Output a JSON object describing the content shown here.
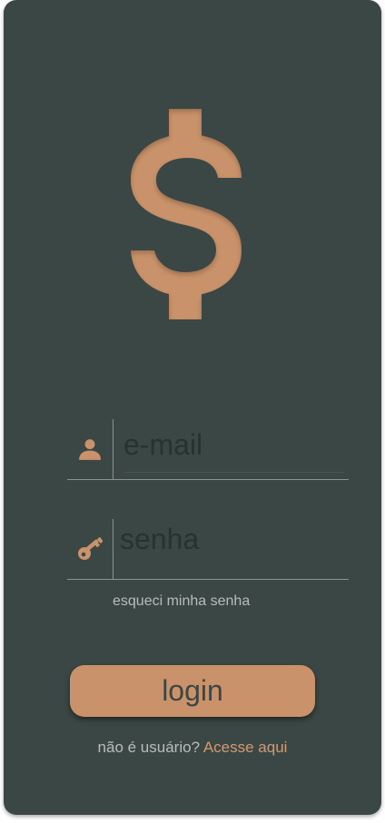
{
  "colors": {
    "background": "#3b4744",
    "accent": "#c9926a",
    "muted_text": "#b8bdbb",
    "link": "#d39a70"
  },
  "logo": {
    "icon": "dollar-sign-icon",
    "glyph": "$"
  },
  "login_form": {
    "email": {
      "icon": "user-icon",
      "placeholder": "e-mail",
      "value": ""
    },
    "password": {
      "icon": "key-icon",
      "placeholder": "senha",
      "value": ""
    },
    "forgot_password_label": "esqueci minha senha",
    "login_button_label": "login"
  },
  "signup": {
    "prompt": "não é usuário?",
    "link_label": "Acesse aqui"
  }
}
